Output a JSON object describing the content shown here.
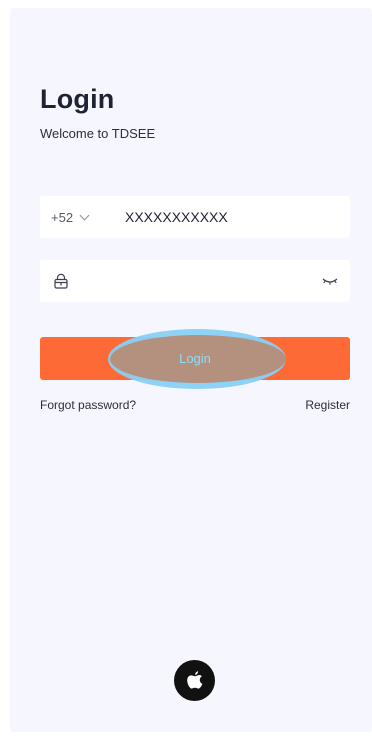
{
  "header": {
    "title": "Login",
    "subtitle": "Welcome to TDSEE"
  },
  "phone": {
    "country_code": "+52",
    "value": "XXXXXXXXXXX"
  },
  "password": {
    "value": ""
  },
  "actions": {
    "login_label": "Login",
    "forgot_label": "Forgot password?",
    "register_label": "Register"
  },
  "icons": {
    "country_chevron": "chevron-down-icon",
    "password_lock": "lock-icon",
    "password_visibility": "eye-closed-icon",
    "social": "apple-icon"
  },
  "colors": {
    "primary": "#fd6a35",
    "background": "#f5f6fe",
    "text": "#1f2233"
  }
}
